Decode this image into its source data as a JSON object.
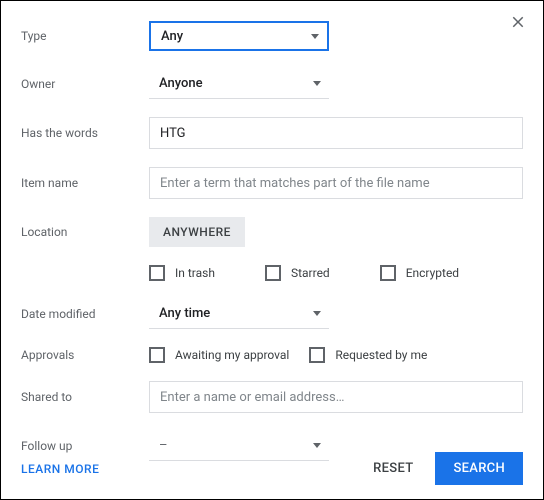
{
  "labels": {
    "type": "Type",
    "owner": "Owner",
    "has_words": "Has the words",
    "item_name": "Item name",
    "location": "Location",
    "date_modified": "Date modified",
    "approvals": "Approvals",
    "shared_to": "Shared to",
    "follow_up": "Follow up"
  },
  "values": {
    "type": "Any",
    "owner": "Anyone",
    "has_words": "HTG",
    "item_name": "",
    "location_chip": "ANYWHERE",
    "date_modified": "Any time",
    "shared_to": "",
    "follow_up": "–"
  },
  "placeholders": {
    "item_name": "Enter a term that matches part of the file name",
    "shared_to": "Enter a name or email address…"
  },
  "checkboxes": {
    "in_trash": "In trash",
    "starred": "Starred",
    "encrypted": "Encrypted",
    "awaiting": "Awaiting my approval",
    "requested": "Requested by me"
  },
  "footer": {
    "learn_more": "LEARN MORE",
    "reset": "RESET",
    "search": "SEARCH"
  }
}
